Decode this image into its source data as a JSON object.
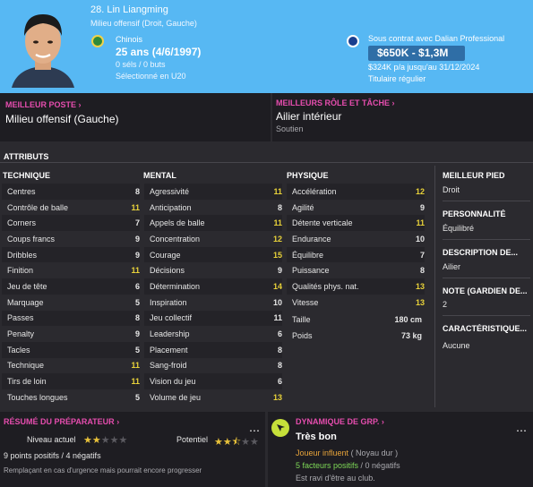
{
  "header": {
    "name": "28. Lin Liangming",
    "position": "Milieu offensif (Droit, Gauche)",
    "nationality": "Chinois",
    "age": "25 ans (4/6/1997)",
    "caps": "0 sél<span>s</span> / 0 buts",
    "caps_text": "0 séls / 0 buts",
    "u20": "Sélectionné en U20",
    "contract": "Sous contrat avec Dalian Professional",
    "value": "$650K - $1,3M",
    "wage": "$324K p/a jusqu'au 31/12/2024",
    "status": "Titulaire régulier"
  },
  "best_position": {
    "label": "MEILLEUR POSTE",
    "value": "Milieu offensif (Gauche)"
  },
  "best_role": {
    "label": "MEILLEURS RÔLE ET TÂCHE",
    "value": "Ailier intérieur",
    "duty": "Soutien"
  },
  "attributes": {
    "title": "ATTRIBUTS",
    "technique": {
      "heading": "TECHNIQUE",
      "rows": [
        {
          "name": "Centres",
          "value": "8",
          "hi": false
        },
        {
          "name": "Contrôle de balle",
          "value": "11",
          "hi": true
        },
        {
          "name": "Corners",
          "value": "7",
          "hi": false
        },
        {
          "name": "Coups francs",
          "value": "9",
          "hi": false
        },
        {
          "name": "Dribbles",
          "value": "9",
          "hi": false
        },
        {
          "name": "Finition",
          "value": "11",
          "hi": true
        },
        {
          "name": "Jeu de tête",
          "value": "6",
          "hi": false
        },
        {
          "name": "Marquage",
          "value": "5",
          "hi": false
        },
        {
          "name": "Passes",
          "value": "8",
          "hi": false
        },
        {
          "name": "Penalty",
          "value": "9",
          "hi": false
        },
        {
          "name": "Tacles",
          "value": "5",
          "hi": false
        },
        {
          "name": "Technique",
          "value": "11",
          "hi": true
        },
        {
          "name": "Tirs de loin",
          "value": "11",
          "hi": true
        },
        {
          "name": "Touches longues",
          "value": "5",
          "hi": false
        }
      ]
    },
    "mental": {
      "heading": "MENTAL",
      "rows": [
        {
          "name": "Agressivité",
          "value": "11",
          "hi": true
        },
        {
          "name": "Anticipation",
          "value": "8",
          "hi": false
        },
        {
          "name": "Appels de balle",
          "value": "11",
          "hi": true
        },
        {
          "name": "Concentration",
          "value": "12",
          "hi": true
        },
        {
          "name": "Courage",
          "value": "15",
          "hi": true
        },
        {
          "name": "Décisions",
          "value": "9",
          "hi": false
        },
        {
          "name": "Détermination",
          "value": "14",
          "hi": true
        },
        {
          "name": "Inspiration",
          "value": "10",
          "hi": false
        },
        {
          "name": "Jeu collectif",
          "value": "11",
          "hi": false
        },
        {
          "name": "Leadership",
          "value": "6",
          "hi": false
        },
        {
          "name": "Placement",
          "value": "8",
          "hi": false
        },
        {
          "name": "Sang-froid",
          "value": "8",
          "hi": false
        },
        {
          "name": "Vision du jeu",
          "value": "6",
          "hi": false
        },
        {
          "name": "Volume de jeu",
          "value": "13",
          "hi": true
        }
      ]
    },
    "physique": {
      "heading": "PHYSIQUE",
      "rows": [
        {
          "name": "Accélération",
          "value": "12",
          "hi": true
        },
        {
          "name": "Agilité",
          "value": "9",
          "hi": false
        },
        {
          "name": "Détente verticale",
          "value": "11",
          "hi": true
        },
        {
          "name": "Endurance",
          "value": "10",
          "hi": false
        },
        {
          "name": "Équilibre",
          "value": "7",
          "hi": false
        },
        {
          "name": "Puissance",
          "value": "8",
          "hi": false
        },
        {
          "name": "Qualités phys. nat.",
          "value": "13",
          "hi": true
        },
        {
          "name": "Vitesse",
          "value": "13",
          "hi": true
        }
      ],
      "height_label": "Taille",
      "height_value": "180 cm",
      "weight_label": "Poids",
      "weight_value": "73 kg"
    }
  },
  "side": {
    "foot_label": "MEILLEUR PIED",
    "foot_value": "Droit",
    "personality_label": "PERSONNALITÉ",
    "personality_value": "Équilibré",
    "media_label": "DESCRIPTION DE...",
    "media_value": "Ailier",
    "gk_label": "NOTE (GARDIEN DE...",
    "gk_value": "2",
    "traits_label": "CARACTÉRISTIQUE...",
    "traits_value": "Aucune"
  },
  "coach_report": {
    "label": "RÉSUMÉ DU PRÉPARATEUR",
    "current_label": "Niveau actuel",
    "current_stars": 2,
    "potential_label": "Potentiel",
    "potential_stars": 2.5,
    "points": "9 points positifs / 4 négatifs",
    "note": "Remplaçant en cas d'urgence mais pourrait encore progresser"
  },
  "dynamics": {
    "label": "DYNAMIQUE DE GRP.",
    "value": "Très bon",
    "influence": "Joueur influent",
    "influence_group": "( Noyau dur )",
    "positives": "5 facteurs positifs",
    "negatives": "/ 0 négatifs",
    "note": "Est ravi d'être au club."
  },
  "colors": {
    "header_bg": "#57b8f3",
    "accent_pink": "#e54dae",
    "highlight_yellow": "#e8d23a",
    "positive_green": "#7ed957",
    "influence_orange": "#e8a43a"
  }
}
